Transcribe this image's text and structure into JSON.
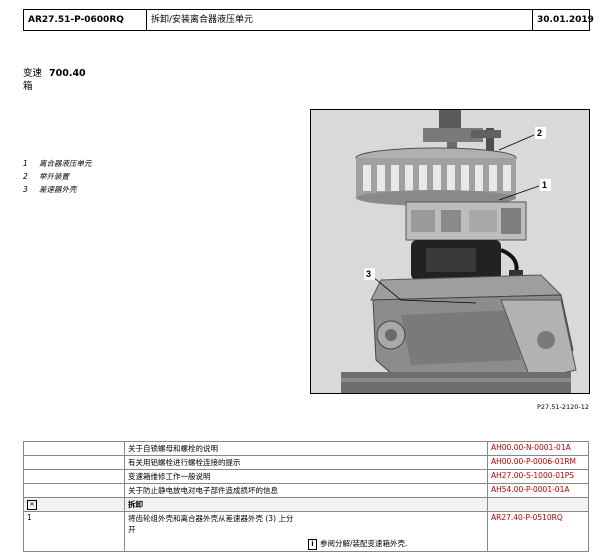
{
  "header": {
    "doc_number": "AR27.51-P-0600RQ",
    "title": "拆卸/安装离合器液压单元",
    "date": "30.01.2019"
  },
  "assembly": {
    "label_line1": "变速",
    "number": "700.40",
    "label_line2": "箱"
  },
  "legend": [
    {
      "num": "1",
      "text": "离合器液压单元"
    },
    {
      "num": "2",
      "text": "举升装置"
    },
    {
      "num": "3",
      "text": "差速器外壳"
    }
  ],
  "figure": {
    "callouts": [
      "1",
      "2",
      "3"
    ],
    "code": "P27.51-2120-12"
  },
  "references": [
    {
      "text": "关于自锁螺母和螺栓的说明",
      "link": "AH00.00-N-0001-01A"
    },
    {
      "text": "有关用铝螺栓进行螺栓连接的提示",
      "link": "AH00.00-P-0006-01RM"
    },
    {
      "text": "变速箱维修工作一般说明",
      "link": "AH27.00-S-1000-01PS"
    },
    {
      "text": "关于防止静电放电对电子部件造成损坏的信息",
      "link": "AH54.00-P-0001-01A"
    }
  ],
  "section": {
    "icon": "removal-icon",
    "label": "拆卸"
  },
  "step": {
    "num": "1",
    "text": "将齿轮组外壳和离合器外壳从差速器外壳 (3) 上分开",
    "note": "参阅分解/装配变速箱外壳.",
    "link": "AR27.40-P-0510RQ"
  },
  "colors": {
    "link": "#c00000",
    "photo_bg": "#d4d4d4"
  }
}
